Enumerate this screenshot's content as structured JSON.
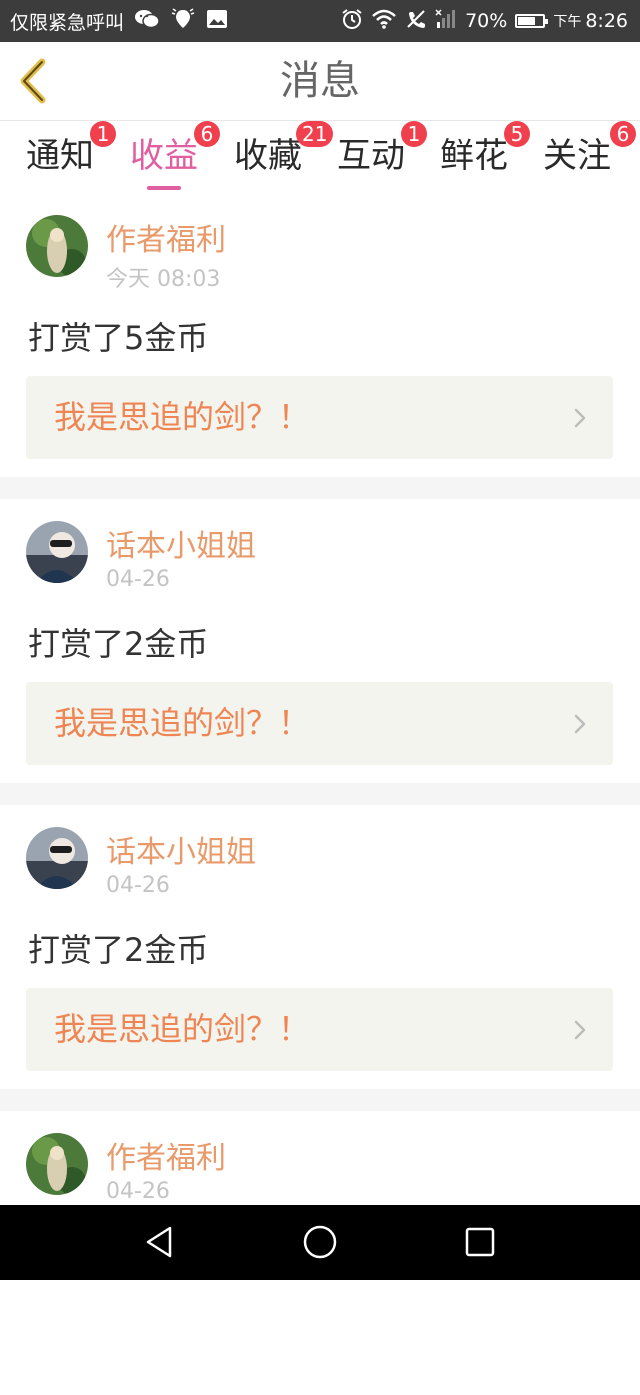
{
  "status_bar": {
    "carrier": "仅限紧急呼叫",
    "battery": "70%",
    "battery_level": 0.7,
    "time_prefix": "下午",
    "time": "8:26"
  },
  "header": {
    "title": "消息"
  },
  "tabs": [
    {
      "label": "通知",
      "badge": "1"
    },
    {
      "label": "收益",
      "badge": "6",
      "active": true
    },
    {
      "label": "收藏",
      "badge": "21"
    },
    {
      "label": "互动",
      "badge": "1"
    },
    {
      "label": "鲜花",
      "badge": "5"
    },
    {
      "label": "关注",
      "badge": "6"
    }
  ],
  "messages": [
    {
      "author": "作者福利",
      "time": "今天 08:03",
      "action": "打赏了5金币",
      "work": "我是思追的剑？！"
    },
    {
      "author": "话本小姐姐",
      "time": "04-26",
      "action": "打赏了2金币",
      "work": "我是思追的剑？！"
    },
    {
      "author": "话本小姐姐",
      "time": "04-26",
      "action": "打赏了2金币",
      "work": "我是思追的剑？！"
    },
    {
      "author": "作者福利",
      "time": "04-26"
    }
  ],
  "colors": {
    "accent_pink": "#e05fa0",
    "author_orange": "#e89a6a",
    "work_orange": "#ee8552",
    "badge_red": "#f0404e"
  }
}
